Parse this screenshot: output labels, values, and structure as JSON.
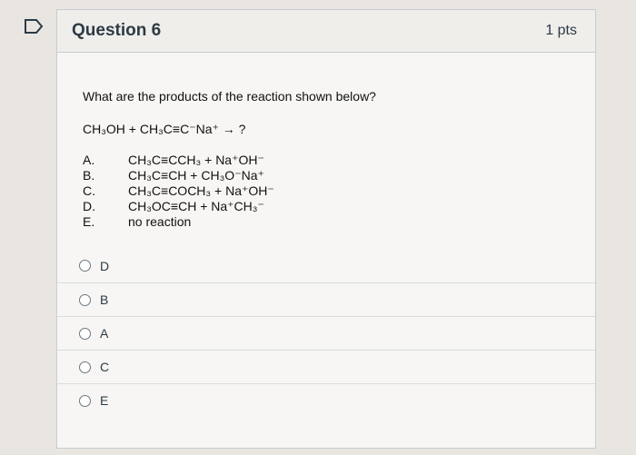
{
  "question": {
    "title": "Question 6",
    "points": "1 pts",
    "prompt": "What are the products of the reaction shown below?",
    "reaction": "CH₃OH + CH₃C≡C⁻Na⁺ → ?",
    "choices": [
      {
        "letter": "A.",
        "text": "CH₃C≡CCH₃ + Na⁺OH⁻"
      },
      {
        "letter": "B.",
        "text": "CH₃C≡CH + CH₃O⁻Na⁺"
      },
      {
        "letter": "C.",
        "text": "CH₃C≡COCH₃ + Na⁺OH⁻"
      },
      {
        "letter": "D.",
        "text": "CH₃OC≡CH + Na⁺CH₃⁻"
      },
      {
        "letter": "E.",
        "text": "no reaction"
      }
    ]
  },
  "answers": [
    {
      "label": "D"
    },
    {
      "label": "B"
    },
    {
      "label": "A"
    },
    {
      "label": "C"
    },
    {
      "label": "E"
    }
  ],
  "colors": {
    "text": "#2d3b45",
    "border": "#c7cdd1",
    "accent": "#2d3b45"
  },
  "icons": {
    "flag": "bookmark-flag-icon"
  }
}
